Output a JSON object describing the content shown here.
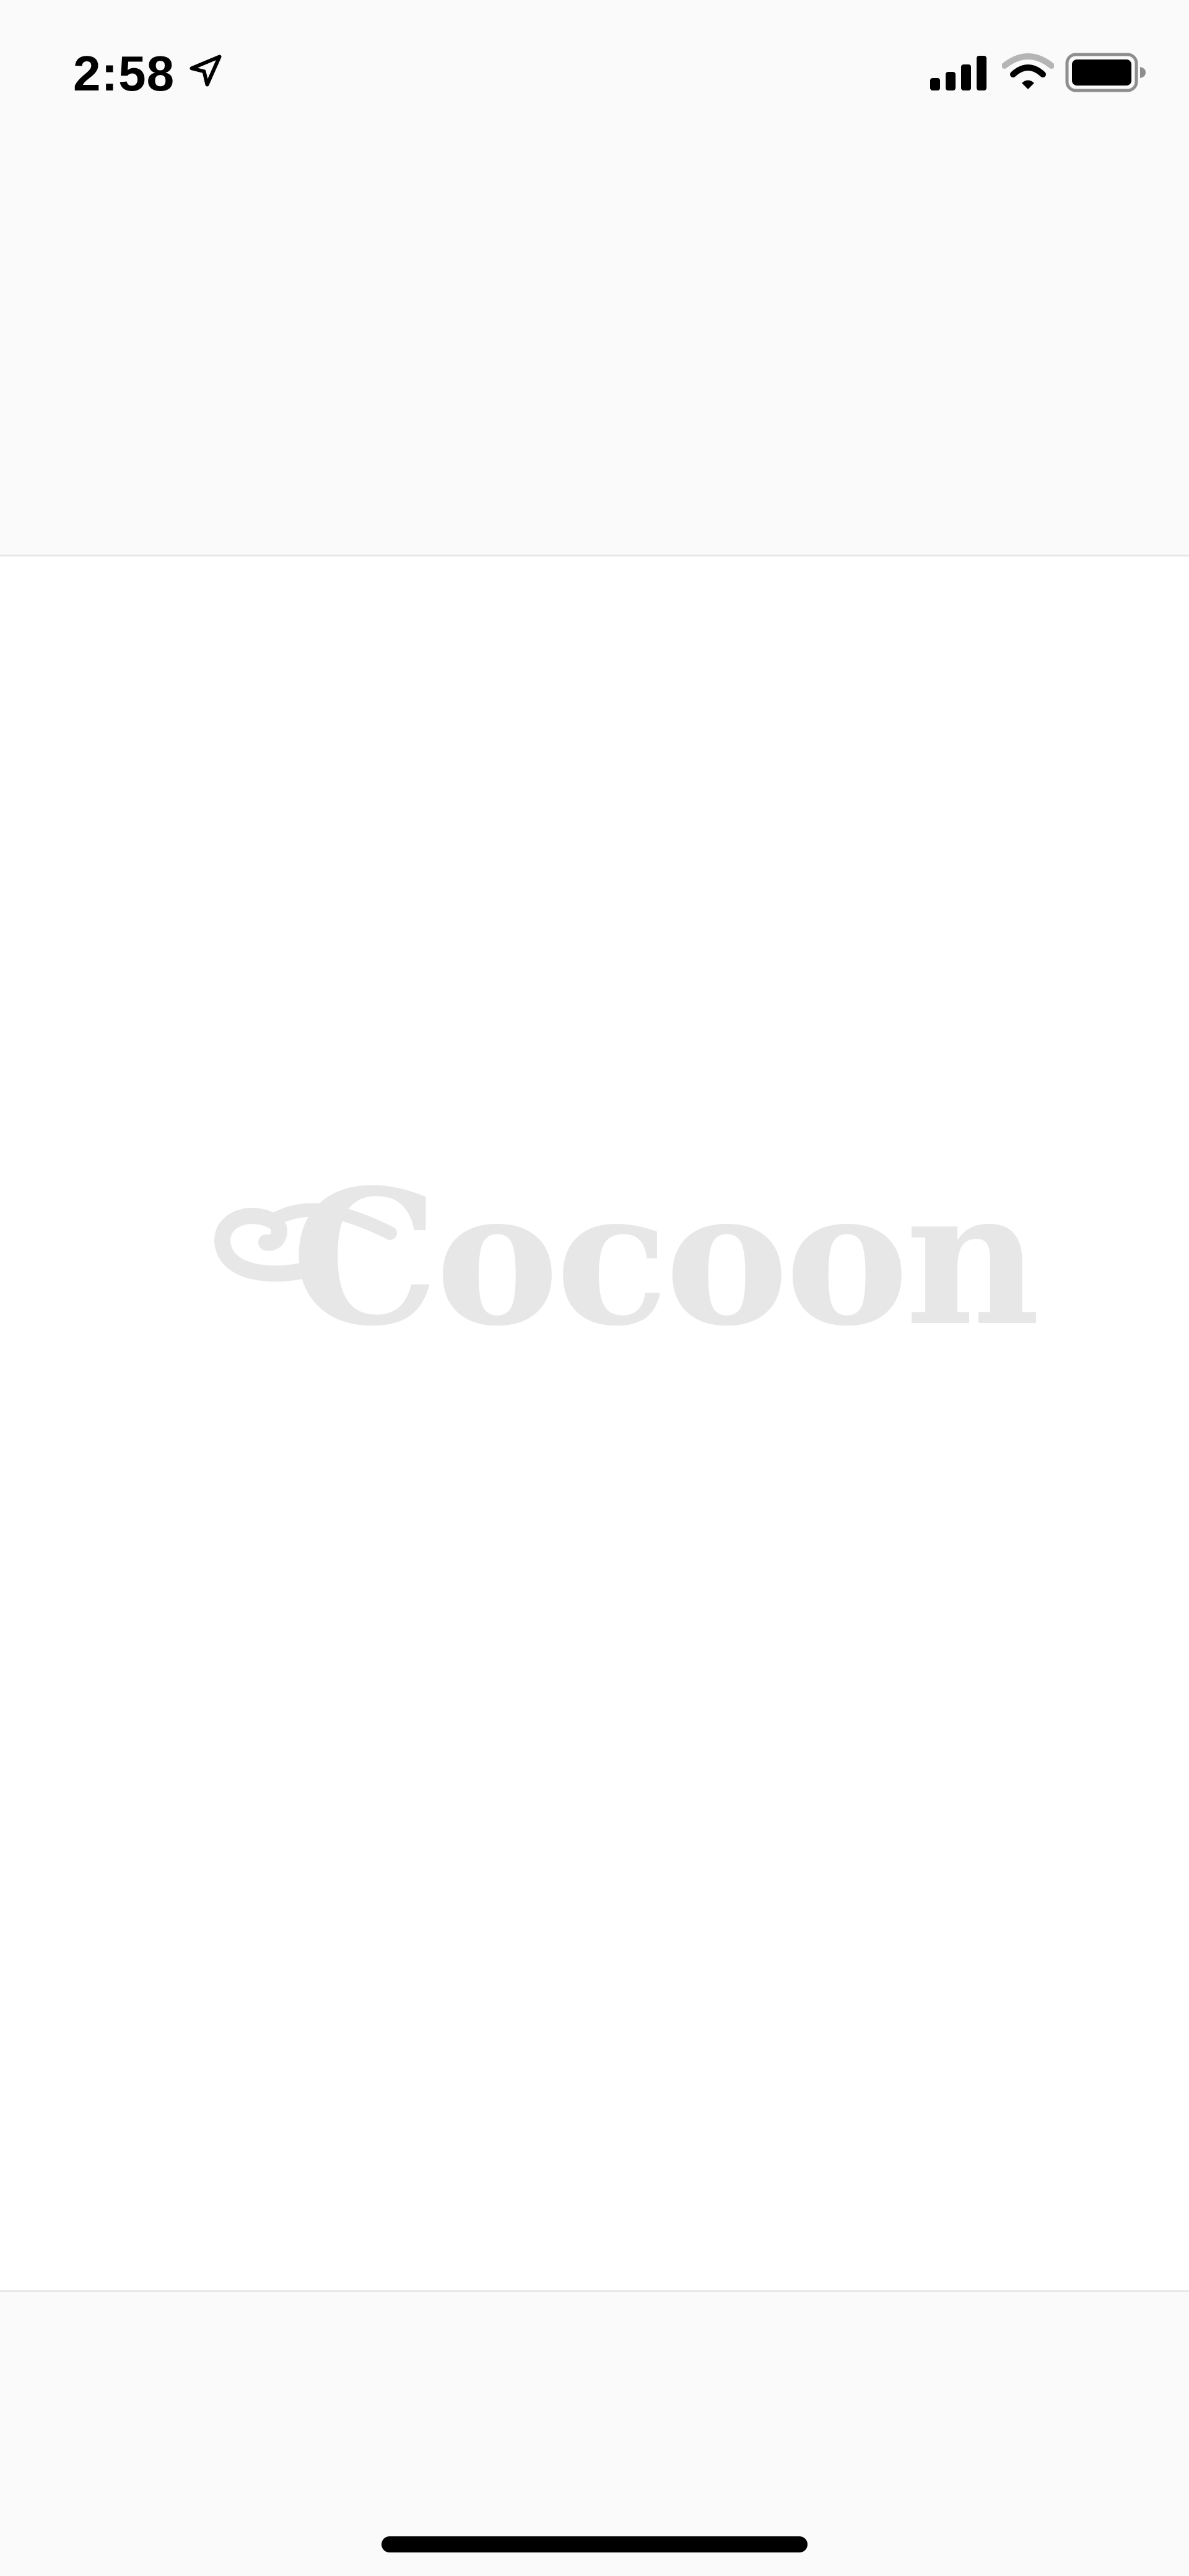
{
  "status_bar": {
    "time": "2:58",
    "location_icon": "location-arrow-icon",
    "signal_icon": "cellular-signal-icon",
    "wifi_icon": "wifi-icon",
    "battery_icon": "battery-icon"
  },
  "logo": {
    "text": "Cocoon",
    "color": "#e7e7e7"
  },
  "colors": {
    "bar_background": "#fafafa",
    "divider": "#e6e6e6",
    "content_background": "#ffffff"
  }
}
